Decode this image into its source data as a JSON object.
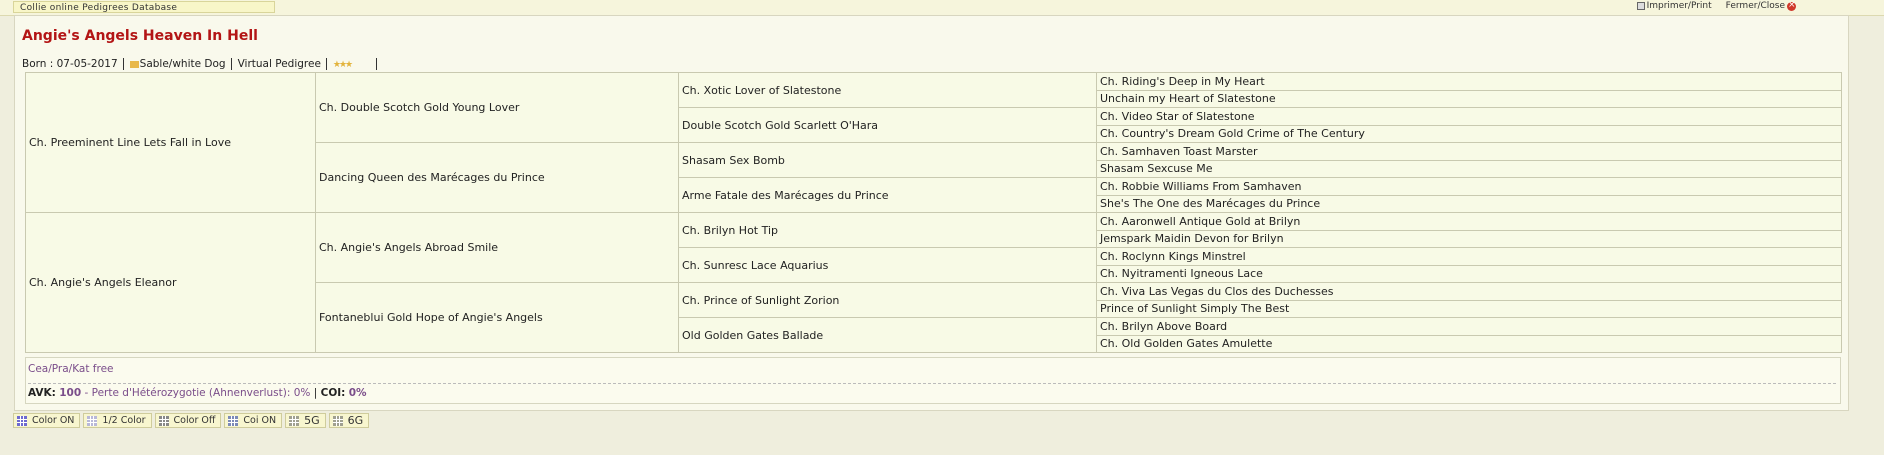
{
  "site_title": "Collie online Pedigrees Database",
  "top_links": {
    "print": "Imprimer/Print",
    "close": "Fermer/Close"
  },
  "dog": {
    "name": "Angie's Angels Heaven In Hell",
    "born": "Born : 07-05-2017",
    "color": "Sable/white Dog",
    "virtual_pedigree": "Virtual Pedigree"
  },
  "pedigree": {
    "parents": [
      "Ch. Preeminent Line Lets Fall in Love",
      "Ch. Angie's Angels Eleanor"
    ],
    "grandparents": [
      "Ch. Double Scotch Gold Young Lover",
      "Dancing Queen des Marécages du Prince",
      "Ch. Angie's Angels Abroad Smile",
      "Fontaneblui Gold Hope of Angie's Angels"
    ],
    "great_grandparents": [
      "Ch. Xotic Lover of Slatestone",
      "Double Scotch Gold Scarlett O'Hara",
      "Shasam Sex Bomb",
      "Arme Fatale des Marécages du Prince",
      "Ch. Brilyn Hot Tip",
      "Ch. Sunresc Lace Aquarius",
      "Ch. Prince of Sunlight Zorion",
      "Old Golden Gates Ballade"
    ],
    "gg_grandparents": [
      "Ch. Riding's Deep in My Heart",
      "Unchain my Heart of Slatestone",
      "Ch. Video Star of Slatestone",
      "Ch. Country's Dream Gold Crime of The Century",
      "Ch. Samhaven Toast Marster",
      "Shasam Sexcuse Me",
      "Ch. Robbie Williams From Samhaven",
      "She's The One des Marécages du Prince",
      "Ch. Aaronwell Antique Gold at Brilyn",
      "Jemspark Maidin Devon for Brilyn",
      "Ch. Roclynn Kings Minstrel",
      "Ch. Nyitramenti Igneous Lace",
      "Ch. Viva Las Vegas du Clos des Duchesses",
      "Prince of Sunlight Simply The Best",
      "Ch. Brilyn Above Board",
      "Ch. Old Golden Gates Amulette"
    ]
  },
  "health": {
    "text": "Cea/Pra/Kat free",
    "avk_label": "AVK:",
    "avk_value": "100",
    "loss_text": "- Perte d'Hétérozygotie (Ahnenverlust): 0%",
    "separator": "|",
    "coi_label": "COI:",
    "coi_value": "0%"
  },
  "buttons": {
    "color_on": "Color ON",
    "half_color": "1/2 Color",
    "color_off": "Color Off",
    "coi_on": "Coi ON",
    "gen5": "5G",
    "gen6": "6G"
  }
}
